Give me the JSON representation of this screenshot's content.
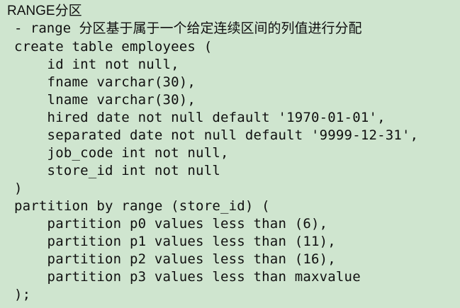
{
  "document": {
    "title": "RANGE分区",
    "subtitle": "- range 分区基于属于一个给定连续区间的列值进行分配",
    "code_lines": [
      "create table employees (",
      "    id int not null,",
      "    fname varchar(30),",
      "    lname varchar(30),",
      "    hired date not null default '1970-01-01',",
      "    separated date not null default '9999-12-31',",
      "    job_code int not null,",
      "    store_id int not null",
      ")",
      "partition by range (store_id) (",
      "    partition p0 values less than (6),",
      "    partition p1 values less than (11),",
      "    partition p2 values less than (16),",
      "    partition p3 values less than maxvalue",
      ");"
    ]
  }
}
